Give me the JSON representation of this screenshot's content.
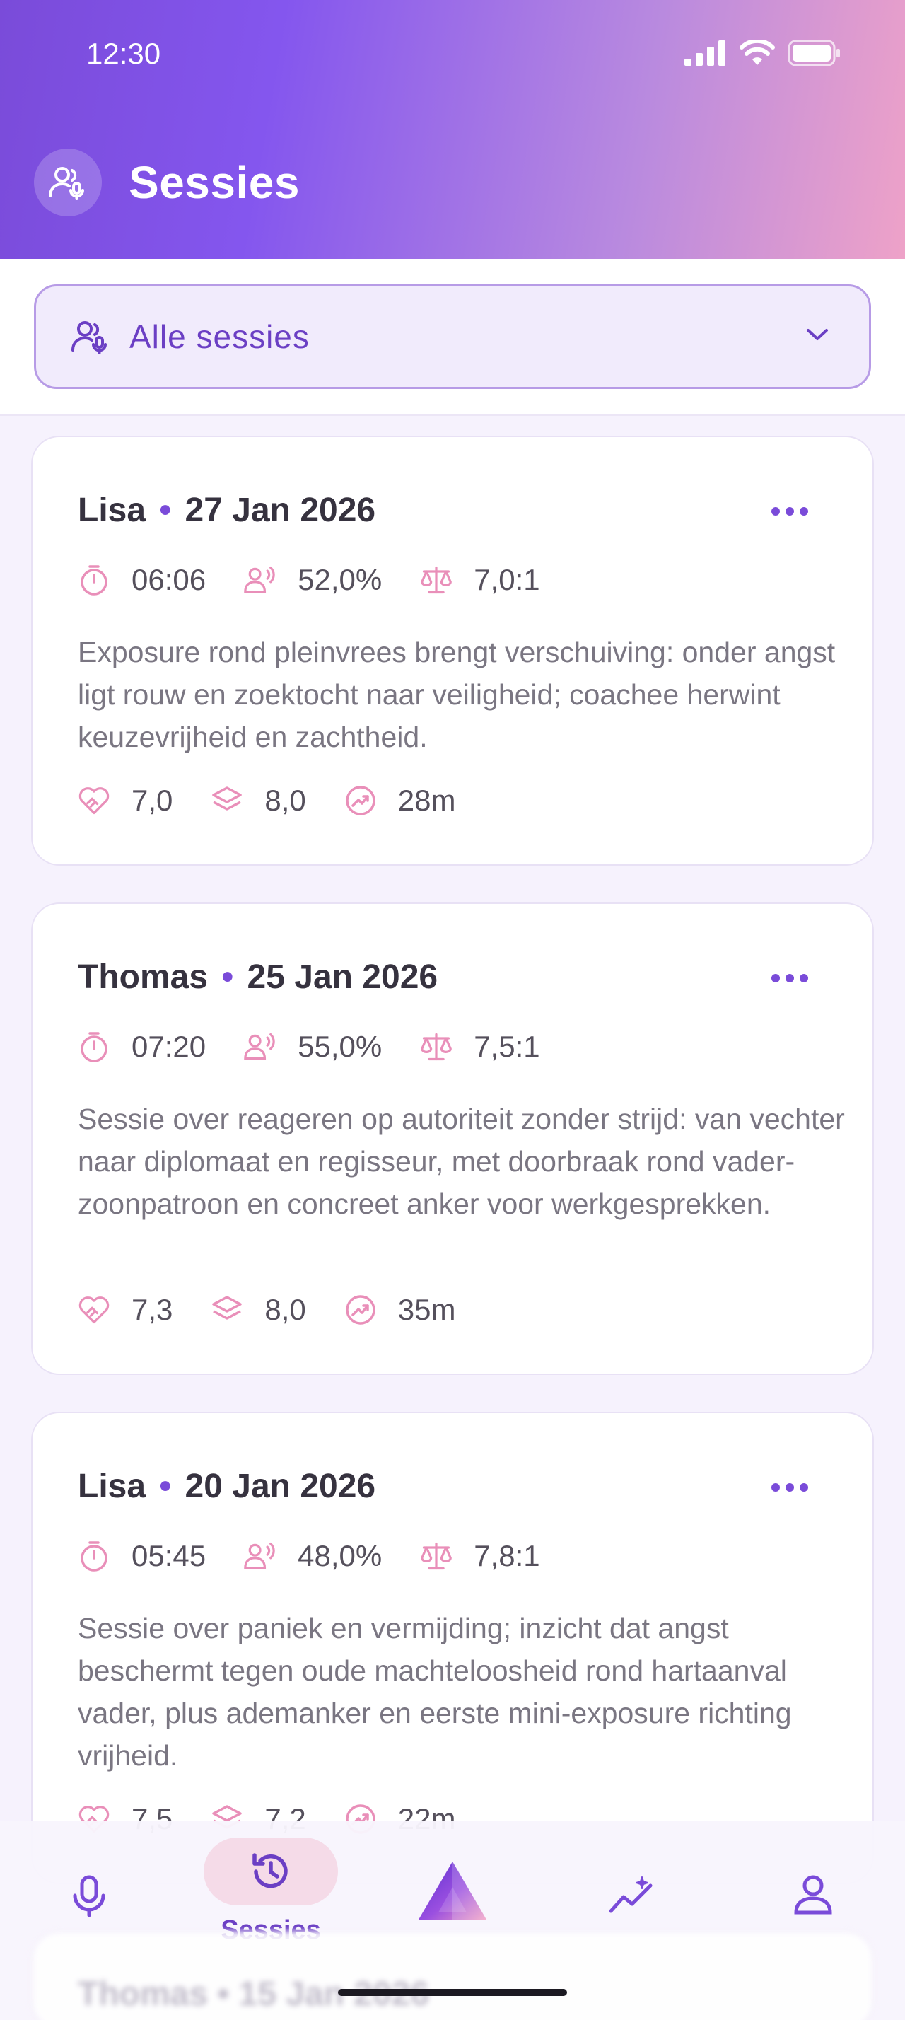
{
  "status_bar": {
    "time": "12:30"
  },
  "header": {
    "title": "Sessies"
  },
  "filter": {
    "label": "Alle sessies"
  },
  "sessions": [
    {
      "name": "Lisa",
      "separator": "•",
      "date": "27 Jan 2026",
      "duration": "06:06",
      "speaking": "52,0%",
      "ratio": "7,0:1",
      "summary": "Exposure rond pleinvrees brengt verschuiving: onder angst ligt rouw en zoektocht naar veiligheid; coachee herwint keuzevrijheid en zachtheid.",
      "rapport": "7,0",
      "depth": "8,0",
      "progress": "28m"
    },
    {
      "name": "Thomas",
      "separator": "•",
      "date": "25 Jan 2026",
      "duration": "07:20",
      "speaking": "55,0%",
      "ratio": "7,5:1",
      "summary": "Sessie over reageren op autoriteit zonder strijd: van vechter naar diplomaat en regisseur, met doorbraak rond vader-zoonpatroon en concreet anker voor werkgesprekken.",
      "rapport": "7,3",
      "depth": "8,0",
      "progress": "35m"
    },
    {
      "name": "Lisa",
      "separator": "•",
      "date": "20 Jan 2026",
      "duration": "05:45",
      "speaking": "48,0%",
      "ratio": "7,8:1",
      "summary": "Sessie over paniek en vermijding; inzicht dat angst beschermt tegen oude machteloosheid rond hartaanval vader, plus ademanker en eerste mini-exposure richting vrijheid.",
      "rapport": "7,5",
      "depth": "7,2",
      "progress": "22m"
    },
    {
      "name": "Thomas",
      "separator": "•",
      "date": "15 Jan 2026"
    }
  ],
  "nav": {
    "sessions_label": "Sessies"
  },
  "colors": {
    "accent": "#7a4bd9",
    "icon_pink": "#e98fb9",
    "nav_active_bg": "#f5dbe8"
  }
}
